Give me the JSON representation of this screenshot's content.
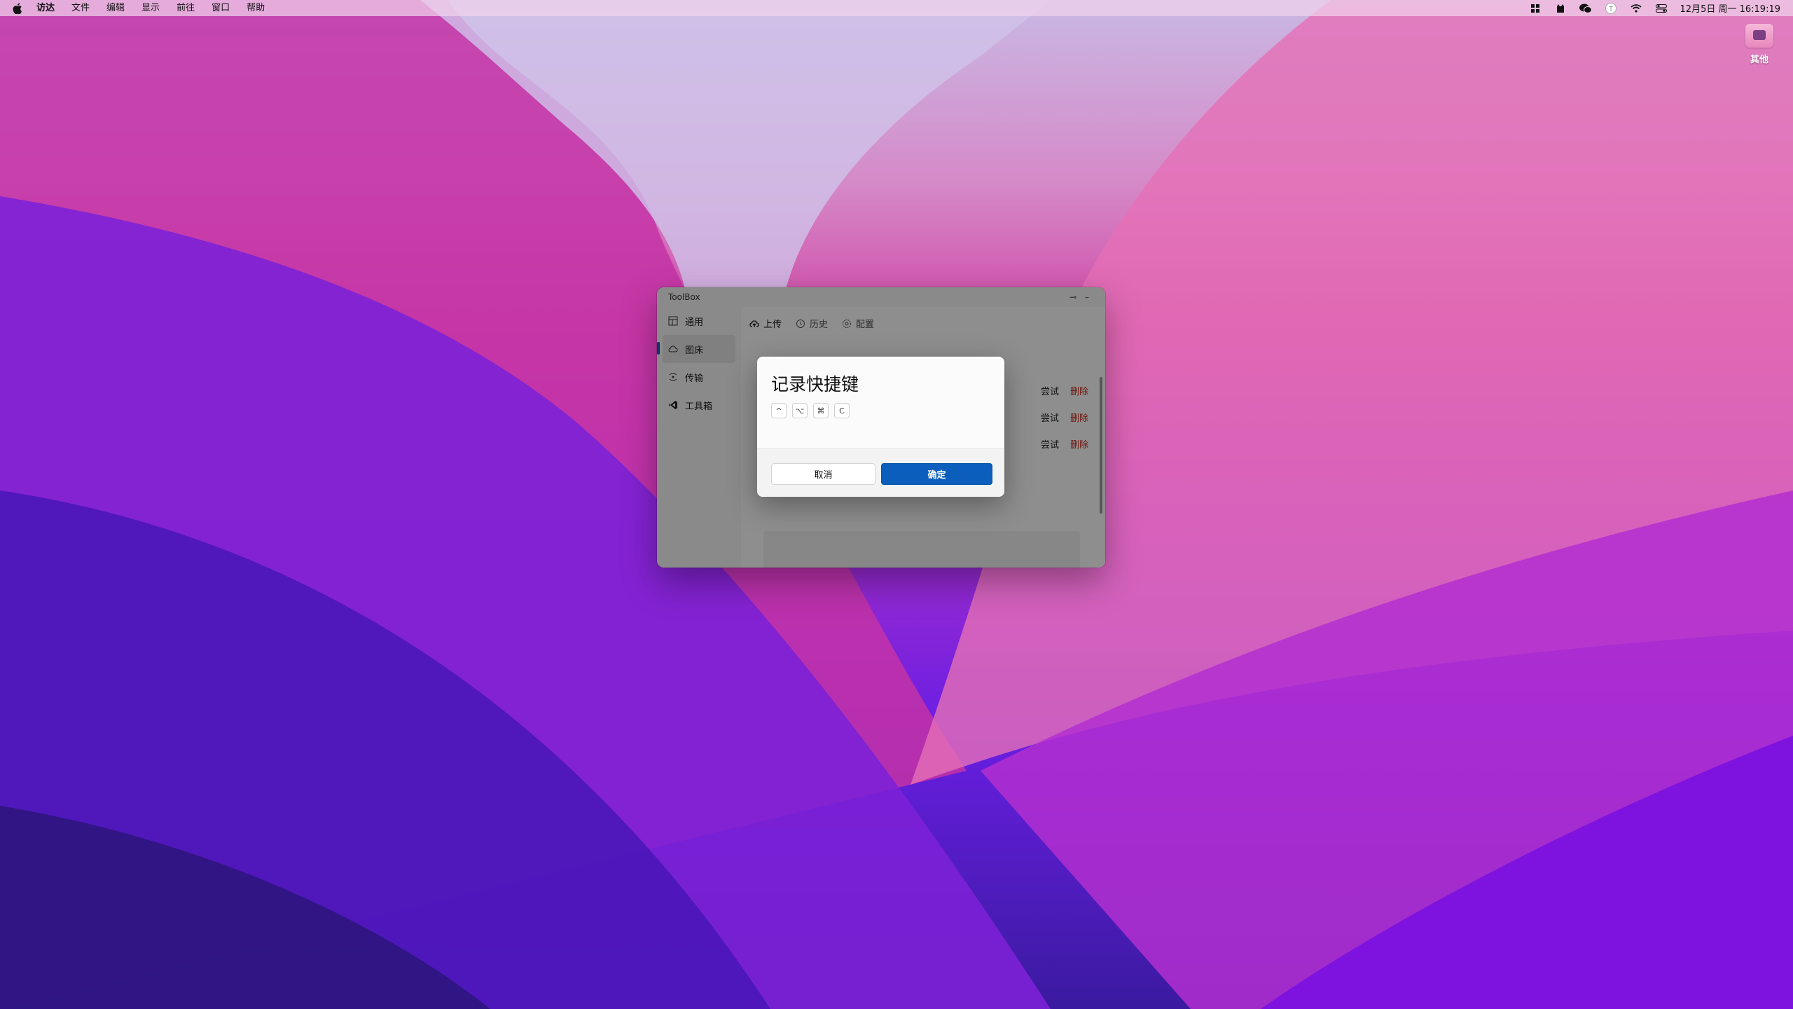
{
  "menubar": {
    "app": "访达",
    "items": [
      "文件",
      "编辑",
      "显示",
      "前往",
      "窗口",
      "帮助"
    ],
    "clock": "12月5日 周一  16:19:19",
    "tray_icons": [
      "grid-icon",
      "cat-icon",
      "wechat-icon",
      "user-t-icon",
      "wifi-icon",
      "control-center-icon"
    ]
  },
  "desktop": {
    "item_label": "其他"
  },
  "window": {
    "title": "ToolBox",
    "pin": "⊸",
    "minimize": "–",
    "sidebar": [
      {
        "label": "通用",
        "icon": "layout-icon"
      },
      {
        "label": "图床",
        "icon": "cloud-icon"
      },
      {
        "label": "传输",
        "icon": "transfer-icon"
      },
      {
        "label": "工具箱",
        "icon": "vscode-icon"
      }
    ],
    "tabs": [
      {
        "label": "上传",
        "icon": "cloud-upload-icon"
      },
      {
        "label": "历史",
        "icon": "history-icon"
      },
      {
        "label": "配置",
        "icon": "settings-icon"
      }
    ],
    "rows": [
      {
        "try": "尝试",
        "delete": "删除"
      },
      {
        "try": "尝试",
        "delete": "删除"
      },
      {
        "try": "尝试",
        "delete": "删除"
      }
    ]
  },
  "dialog": {
    "title": "记录快捷键",
    "keys": [
      "^",
      "⌥",
      "⌘",
      "C"
    ],
    "cancel": "取消",
    "ok": "确定"
  }
}
